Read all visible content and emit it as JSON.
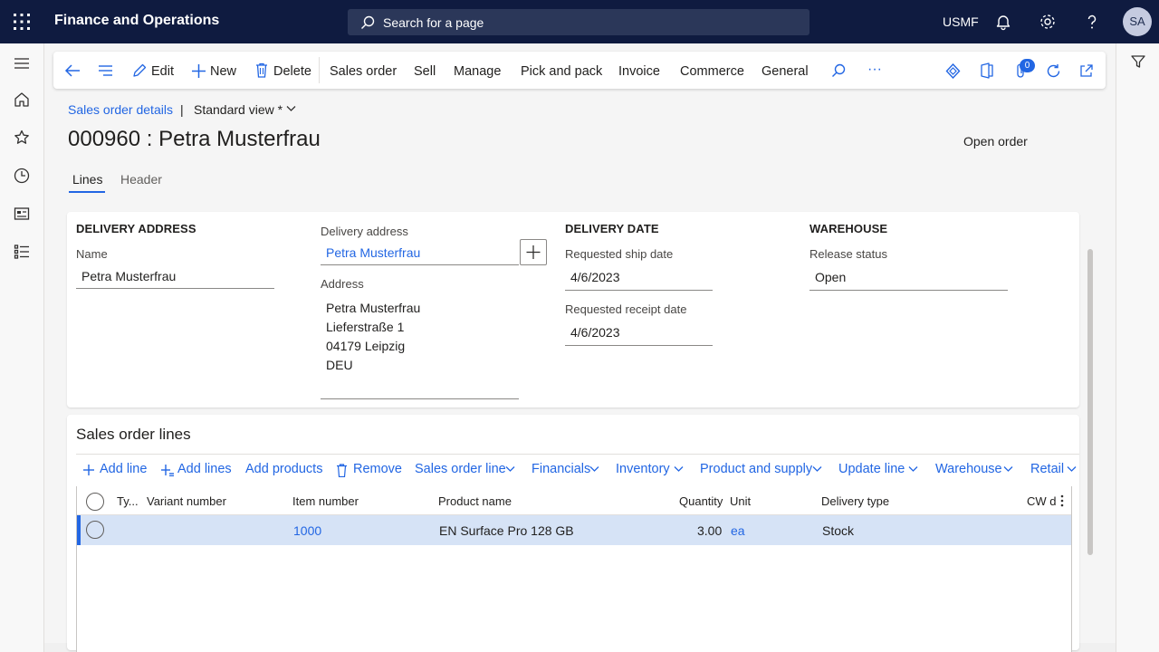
{
  "topbar": {
    "app_title": "Finance and Operations",
    "search_placeholder": "Search for a page",
    "company": "USMF",
    "avatar_initials": "SA"
  },
  "action_pane": {
    "edit": "Edit",
    "new": "New",
    "delete": "Delete",
    "tabs": [
      "Sales order",
      "Sell",
      "Manage",
      "Pick and pack",
      "Invoice",
      "Commerce",
      "General"
    ],
    "more": "···",
    "badge_count": "0"
  },
  "header": {
    "breadcrumb": "Sales order details",
    "separator": "|",
    "view": "Standard view *",
    "title": "000960 : Petra Musterfrau",
    "status": "Open order",
    "tabs": [
      "Lines",
      "Header"
    ]
  },
  "delivery_address": {
    "section": "DELIVERY ADDRESS",
    "name_label": "Name",
    "name_value": "Petra Musterfrau",
    "address_label": "Delivery address",
    "address_value": "Petra Musterfrau",
    "full_address_label": "Address",
    "address_lines": [
      "Petra Musterfrau",
      "Lieferstraße 1",
      "04179 Leipzig",
      "DEU"
    ]
  },
  "delivery_date": {
    "section": "DELIVERY DATE",
    "ship_label": "Requested ship date",
    "ship_value": "4/6/2023",
    "receipt_label": "Requested receipt date",
    "receipt_value": "4/6/2023"
  },
  "warehouse": {
    "section": "WAREHOUSE",
    "release_label": "Release status",
    "release_value": "Open"
  },
  "lines": {
    "title": "Sales order lines",
    "toolbar": {
      "add_line": "Add line",
      "add_lines": "Add lines",
      "add_products": "Add products",
      "remove": "Remove",
      "menus": [
        "Sales order line",
        "Financials",
        "Inventory",
        "Product and supply",
        "Update line",
        "Warehouse",
        "Retail"
      ]
    },
    "columns": [
      "Ty...",
      "Variant number",
      "Item number",
      "Product name",
      "Quantity",
      "Unit",
      "Delivery type",
      "CW d"
    ],
    "rows": [
      {
        "type": "",
        "variant": "",
        "item": "1000",
        "product": "EN Surface Pro 128 GB",
        "quantity": "3.00",
        "unit": "ea",
        "delivery_type": "Stock"
      }
    ]
  },
  "colors": {
    "topbar": "#0f1b40",
    "accent": "#2266e3",
    "selected_row": "#d6e3f6"
  }
}
